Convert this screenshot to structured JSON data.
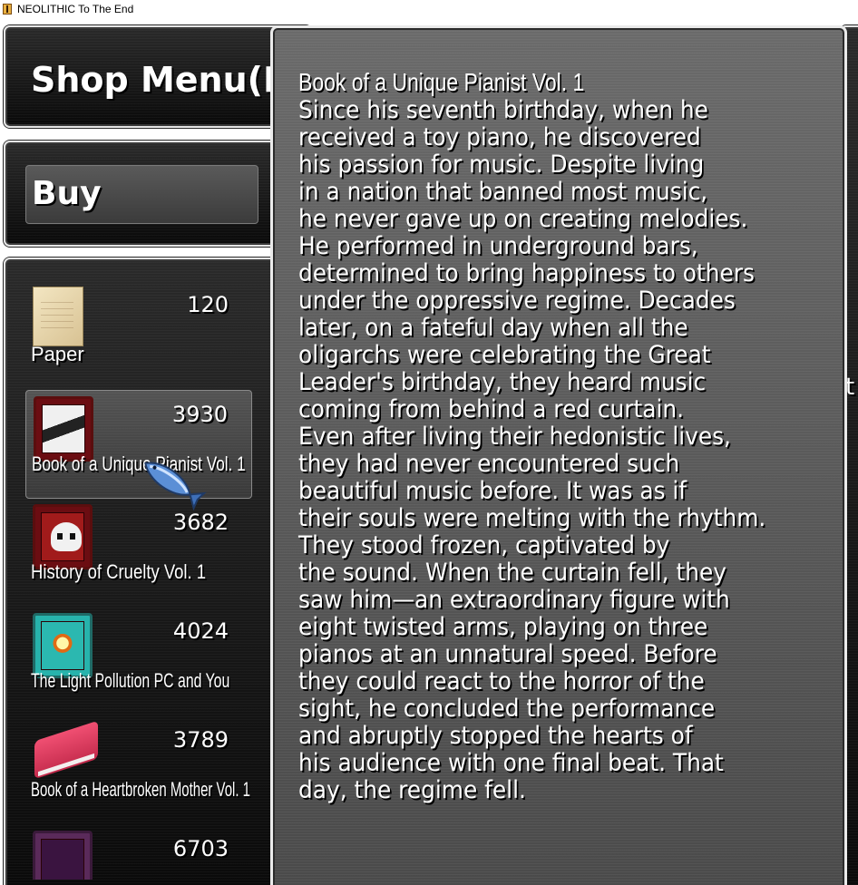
{
  "window": {
    "title": "NEOLITHIC To The End"
  },
  "shop": {
    "title": "Shop Menu(Pre",
    "command": "Buy",
    "right_edge_glyph": "t"
  },
  "items": [
    {
      "name": "Paper",
      "price": "120",
      "icon": "paper-icon"
    },
    {
      "name": "Book of a Unique Pianist Vol. 1",
      "price": "3930",
      "icon": "piano-book-icon"
    },
    {
      "name": "History of Cruelty Vol. 1",
      "price": "3682",
      "icon": "skull-book-icon"
    },
    {
      "name": "The Light Pollution PC and You",
      "price": "4024",
      "icon": "burst-book-icon"
    },
    {
      "name": "Book of a Heartbroken Mother Vol. 1",
      "price": "3789",
      "icon": "pink-book-icon"
    },
    {
      "name": "",
      "price": "6703",
      "icon": "purple-book-icon"
    }
  ],
  "description": {
    "title": "Book of a Unique Pianist Vol. 1",
    "lines": [
      "Since his seventh birthday, when he",
      "received a toy piano, he discovered",
      "his passion for music. Despite living",
      "in a nation that banned most music,",
      "he never gave up on creating melodies.",
      "He performed in underground bars,",
      "determined to bring happiness to others",
      "under the oppressive regime. Decades",
      "later, on a fateful day when all the",
      "oligarchs were celebrating the Great",
      "Leader's birthday, they heard music",
      "coming from behind a red curtain.",
      "Even after living their hedonistic lives,",
      "they had never encountered such",
      "beautiful music before. It was as if",
      "their souls were melting with the rhythm.",
      "They stood frozen, captivated by",
      "the sound. When the curtain fell, they",
      "saw him—an extraordinary figure with",
      "eight twisted arms, playing on three",
      "pianos at an unnatural speed. Before",
      "they could react to the horror of the",
      "sight, he concluded the performance",
      "and abruptly stopped the hearts of",
      "his audience with one final beat. That",
      "day, the regime fell."
    ]
  },
  "colors": {
    "window_border": "#e6e6e6",
    "window_bg_top": "#2a2a2a",
    "window_bg_bottom": "#0a0a0a",
    "desc_bg": "#5a5a5a",
    "text": "#ffffff"
  }
}
